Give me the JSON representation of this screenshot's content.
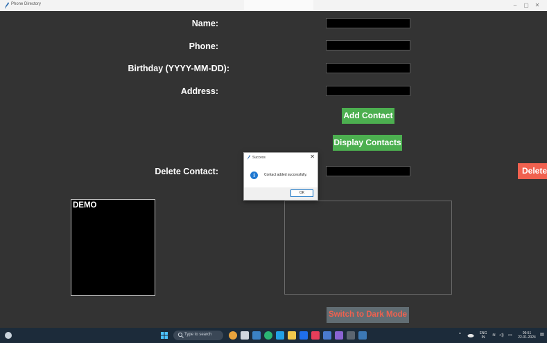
{
  "window": {
    "title": "Phone Directory",
    "minimize": "–",
    "maximize": "▢",
    "close": "✕"
  },
  "form": {
    "name_label": "Name:",
    "phone_label": "Phone:",
    "birthday_label": "Birthday (YYYY-MM-DD):",
    "address_label": "Address:",
    "delete_label": "Delete Contact:",
    "name_value": "",
    "phone_value": "",
    "birthday_value": "",
    "address_value": "",
    "delete_value": ""
  },
  "buttons": {
    "add_contact": "Add Contact",
    "display_contacts": "Display Contacts",
    "delete": "Delete",
    "switch_mode": "Switch to Dark Mode"
  },
  "demo_box": {
    "label": "DEMO"
  },
  "dialog": {
    "title": "Success",
    "close": "✕",
    "message": "Contact added successfully.",
    "ok": "OK",
    "icon": "info-icon"
  },
  "taskbar": {
    "search_placeholder": "Type to search",
    "lang_top": "ENG",
    "lang_bottom": "IN",
    "time": "09:51",
    "date": "22-01-2024"
  },
  "colors": {
    "background": "#333333",
    "green_button": "#4caf50",
    "delete_button": "#f0614f",
    "mode_button": "#616d73",
    "mode_text": "#f0614f"
  }
}
